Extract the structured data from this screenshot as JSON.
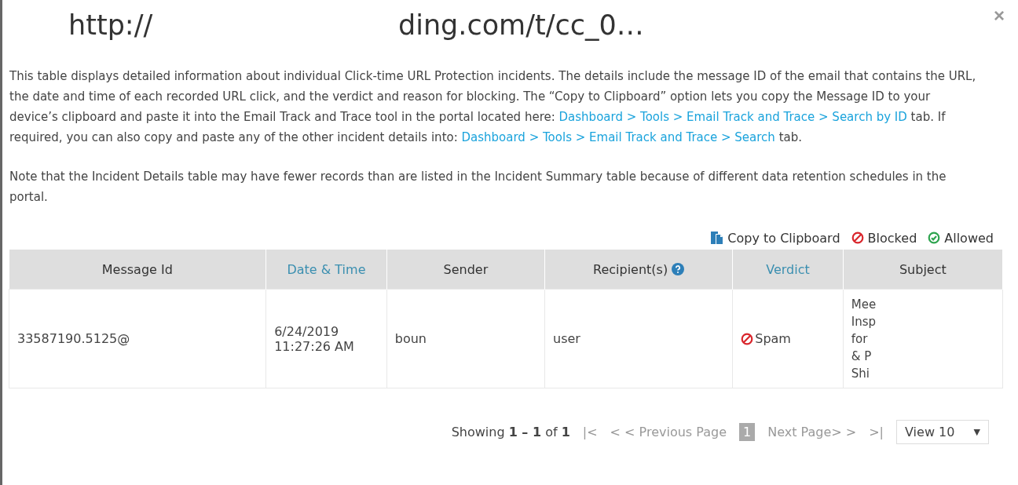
{
  "dialog": {
    "title_parts": [
      "http://",
      "ding.com/t/cc",
      "_0…"
    ],
    "close": "×"
  },
  "description": [
    {
      "segments": [
        {
          "text": "This table displays detailed information about individual Click-time URL Protection incidents. The details include the message ID of the email that contains the URL, the date and time of each recorded URL click, and the verdict and reason for blocking. The “Copy to Clipboard” option lets you copy the Message ID to your device’s clipboard and paste it into the Email Track and Trace tool in the portal located here: ",
          "link": false
        },
        {
          "text": "Dashboard > Tools > Email Track and Trace > Search by ID",
          "link": true
        },
        {
          "text": " tab. If required, you can also copy and paste any of the other incident details into: ",
          "link": false
        },
        {
          "text": "Dashboard > Tools > Email Track and Trace > Search",
          "link": true
        },
        {
          "text": " tab.",
          "link": false
        }
      ]
    },
    {
      "segments": [
        {
          "text": "Note that the Incident Details table may have fewer records than are listed in the Incident Summary table because of different data retention schedules in the portal.",
          "link": false
        }
      ]
    }
  ],
  "legend": [
    {
      "kind": "copy",
      "label": "Copy to Clipboard"
    },
    {
      "kind": "blocked",
      "label": "Blocked"
    },
    {
      "kind": "allowed",
      "label": "Allowed"
    }
  ],
  "table": {
    "columns": [
      {
        "label": "Message Id",
        "sortable": false,
        "help": false
      },
      {
        "label": "Date & Time",
        "sortable": true,
        "help": false
      },
      {
        "label": "Sender",
        "sortable": false,
        "help": false
      },
      {
        "label": "Recipient(s)",
        "sortable": false,
        "help": true
      },
      {
        "label": "Verdict",
        "sortable": true,
        "help": false
      },
      {
        "label": "Subject",
        "sortable": false,
        "help": false
      }
    ],
    "rows": [
      {
        "message_id": "33587190.5125@",
        "date": [
          "6/24/2019",
          "11:27:26 AM"
        ],
        "sender": "boun",
        "recipient": "user",
        "verdict": {
          "blocked": true,
          "label": "Spam"
        },
        "subject": [
          "Mee",
          "Insp",
          "for",
          "& P",
          "Shi"
        ]
      }
    ]
  },
  "pagination": {
    "summary": "Showing **1 – 1** of **1**",
    "first": "|<",
    "previous": "< < Previous Page",
    "pages": [
      {
        "label": "1",
        "selected": true
      }
    ],
    "next": "Next Page> >",
    "last": ">|",
    "page_size": "View 10",
    "caret": "▼"
  }
}
